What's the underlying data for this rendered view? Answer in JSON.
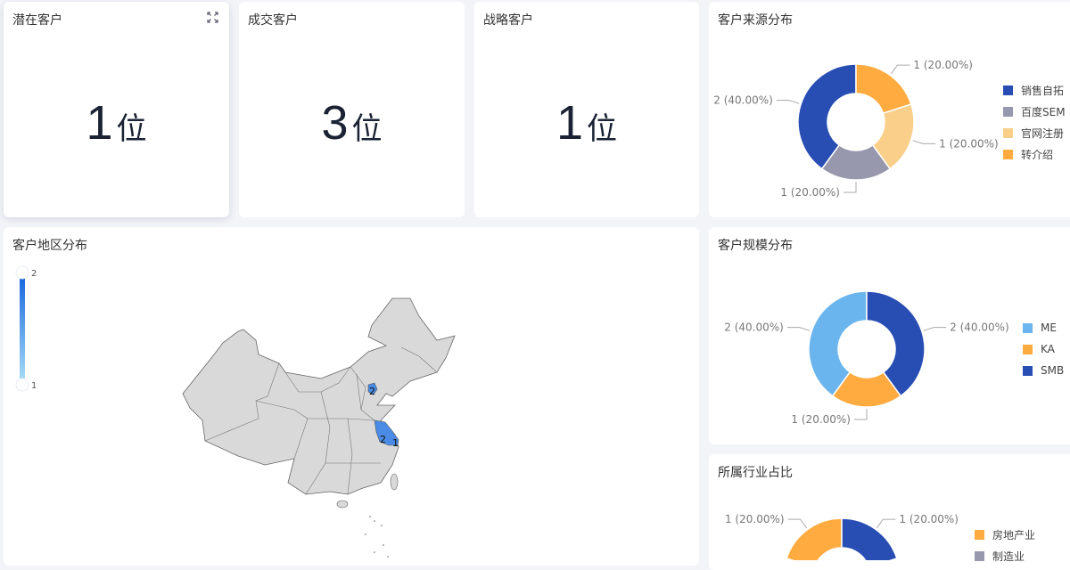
{
  "kpis": [
    {
      "title": "潜在客户",
      "value": "1",
      "unit": "位"
    },
    {
      "title": "成交客户",
      "value": "3",
      "unit": "位"
    },
    {
      "title": "战略客户",
      "value": "1",
      "unit": "位"
    }
  ],
  "map": {
    "title": "客户地区分布",
    "visual_max": "2",
    "visual_min": "1",
    "regions": [
      {
        "name": "北京",
        "value": "2"
      },
      {
        "name": "江苏",
        "value": "2"
      },
      {
        "name": "上海",
        "value": "1"
      }
    ],
    "colors": {
      "high": "#1a6ae0",
      "low": "#a8dcf5",
      "region": "#4a8be6",
      "base": "#d9d9d9"
    }
  },
  "chart_data": [
    {
      "type": "pie",
      "title": "客户来源分布",
      "slices": [
        {
          "name": "销售自拓",
          "value": 2,
          "label": "2 (40.00%)",
          "color": "#284eb4"
        },
        {
          "name": "百度SEM",
          "value": 1,
          "label": "1 (20.00%)",
          "color": "#9797ad"
        },
        {
          "name": "官网注册",
          "value": 1,
          "label": "1 (20.00%)",
          "color": "#f9cf8a"
        },
        {
          "name": "转介绍",
          "value": 1,
          "label": "1 (20.00%)",
          "color": "#ffab40"
        }
      ]
    },
    {
      "type": "pie",
      "title": "客户规模分布",
      "slices": [
        {
          "name": "ME",
          "value": 2,
          "label": "2 (40.00%)",
          "color": "#6bb5ee"
        },
        {
          "name": "KA",
          "value": 1,
          "label": "1 (20.00%)",
          "color": "#ffab40"
        },
        {
          "name": "SMB",
          "value": 2,
          "label": "2 (40.00%)",
          "color": "#284eb4"
        }
      ]
    },
    {
      "type": "pie",
      "title": "所属行业占比",
      "slices": [
        {
          "name": "房地产业",
          "value": 1,
          "label": "1 (20.00%)",
          "color": "#ffab40",
          "share": 0.2,
          "start": 0
        },
        {
          "name": "制造业",
          "value": null,
          "label": null,
          "color": "#9797ad"
        },
        {
          "name": "",
          "value": 1,
          "label": "1 (20.00%)",
          "color": "#284eb4",
          "share": 0.2,
          "start": 0.8
        }
      ]
    }
  ]
}
